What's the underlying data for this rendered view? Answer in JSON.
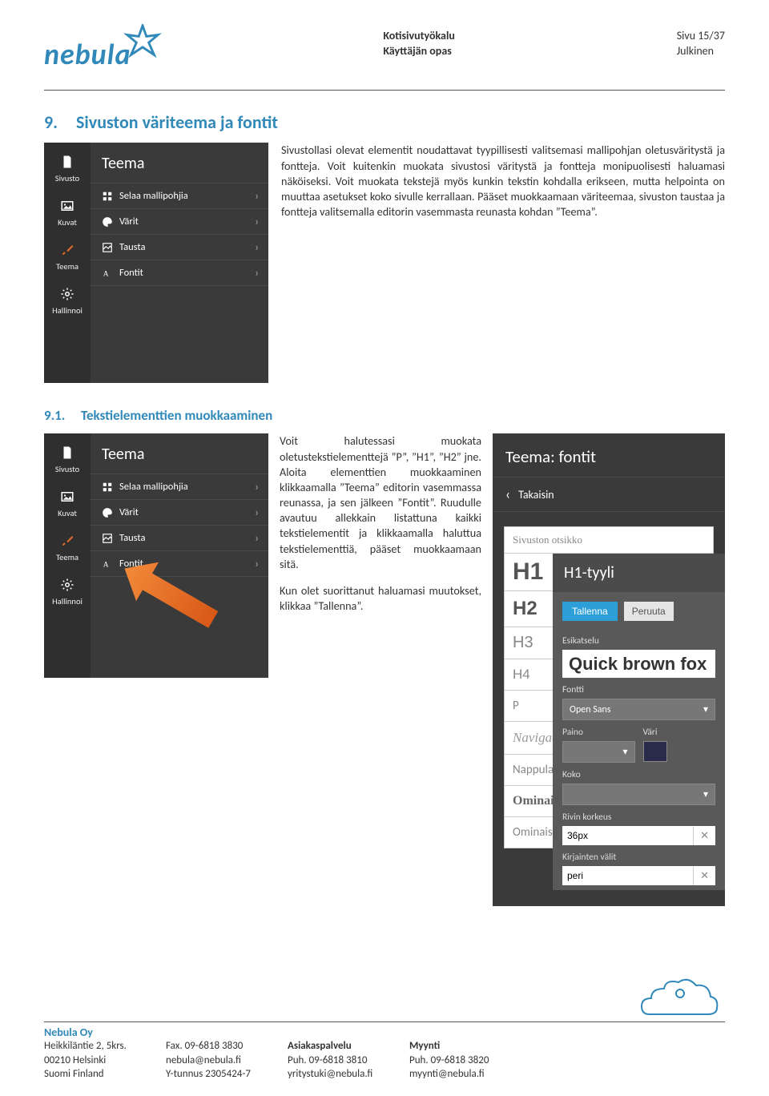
{
  "header": {
    "brand": "nebula",
    "doc_title": "Kotisivutyökalu",
    "doc_sub": "Käyttäjän opas",
    "page_info": "Sivu 15/37",
    "classification": "Julkinen"
  },
  "section9": {
    "num": "9.",
    "title": "Sivuston väriteema ja fontit",
    "p1": "Sivustollasi olevat elementit noudattavat tyypillisesti valitsemasi mallipohjan oletusväritystä ja fontteja. Voit kuitenkin muokata sivustosi väritystä ja fontteja monipuolisesti haluamasi näköiseksi. Voit muokata tekstejä myös kunkin tekstin kohdalla erikseen, mutta helpointa on muuttaa asetukset koko sivulle kerrallaan. Pääset muokkaamaan väriteemaa, sivuston taustaa ja fontteja valitsemalla editorin vasemmasta reunasta kohdan ”Teema”."
  },
  "editor1": {
    "title": "Teema",
    "side": {
      "sivusto": "Sivusto",
      "kuvat": "Kuvat",
      "teema": "Teema",
      "hallinnoi": "Hallinnoi"
    },
    "items": {
      "selaa": "Selaa mallipohjia",
      "varit": "Värit",
      "tausta": "Tausta",
      "fontit": "Fontit"
    }
  },
  "section91": {
    "num": "9.1.",
    "title": "Tekstielementtien muokkaaminen",
    "p1": "Voit halutessasi muokata oletustekstielementtejä ”P”, ”H1”, ”H2” jne. Aloita elementtien muokkaaminen klikkaamalla ”Teema” editorin vasemmassa reunassa, ja sen jälkeen ”Fontit”. Ruudulle avautuu allekkain listattuna kaikki tekstielementit ja klikkaamalla haluttua tekstielementtiä, pääset muokkaamaan sitä.",
    "p2": "Kun olet suorittanut haluamasi muutokset, klikkaa ”Tallenna”."
  },
  "fontsPanel": {
    "title": "Teema: fontit",
    "back": "Takaisin",
    "heading_label": "Sivuston otsikko",
    "h1": "H1",
    "h2": "H2",
    "h3": "H3",
    "h4": "H4",
    "p": "P",
    "nav": "Navigaat",
    "nap": "Nappulat",
    "om1": "Ominaisu",
    "om2": "Ominaisu"
  },
  "stylePanel": {
    "title": "H1-tyyli",
    "save": "Tallenna",
    "cancel": "Peruuta",
    "preview_lbl": "Esikatselu",
    "preview_text": "Quick brown fox",
    "font_lbl": "Fontti",
    "font_val": "Open Sans",
    "paino_lbl": "Paino",
    "vari_lbl": "Väri",
    "koko_lbl": "Koko",
    "rivin_lbl": "Rivin korkeus",
    "rivin_val": "36px",
    "kirj_lbl": "Kirjainten välit",
    "kirj_val": "peri"
  },
  "footer": {
    "company": "Nebula Oy",
    "col1": {
      "a": "Heikkiläntie 2, 5krs.",
      "b": "00210 Helsinki",
      "c": "Suomi Finland"
    },
    "col2": {
      "a": "Fax. 09-6818 3830",
      "b": "nebula@nebula.fi",
      "c": "Y-tunnus 2305424-7"
    },
    "col3": {
      "h": "Asiakaspalvelu",
      "a": "Puh. 09-6818 3810",
      "b": "yritystuki@nebula.fi"
    },
    "col4": {
      "h": "Myynti",
      "a": "Puh. 09-6818 3820",
      "b": "myynti@nebula.fi"
    }
  }
}
